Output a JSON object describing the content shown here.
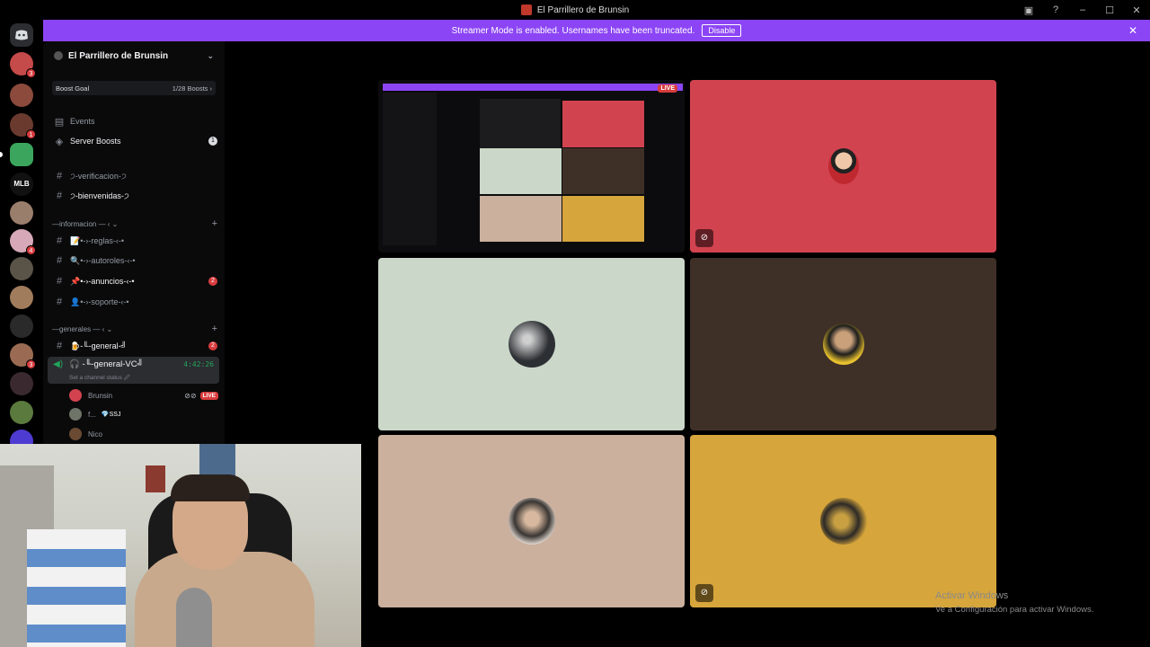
{
  "window": {
    "title": "El Parrillero de Brunsin"
  },
  "banner": {
    "text": "Streamer Mode is enabled. Usernames have been truncated.",
    "button": "Disable"
  },
  "server": {
    "name": "El Parrillero de Brunsin"
  },
  "boost_goal": {
    "label": "Boost Goal",
    "value": "1/28 Boosts ›"
  },
  "menu": {
    "events": "Events",
    "server_boosts": "Server Boosts",
    "server_boosts_count": "1"
  },
  "channels_top": [
    {
      "name": "੭-verificacion-੭"
    },
    {
      "name": "੭-bienvenidas-੭"
    }
  ],
  "category_info": "—informacion — ‹ ⌄",
  "channels_info": [
    {
      "name": "📝•-›-reglas-‹-•"
    },
    {
      "name": "🔍•-›-autoroles-‹-•"
    },
    {
      "name": "📌•-›-anuncios-‹-•",
      "count": "2"
    },
    {
      "name": "👤•-›-soporte-‹-•"
    }
  ],
  "category_general": "—generales — ‹ ⌄",
  "channel_general": {
    "name": "🍺-╙-general-╝",
    "count": "2"
  },
  "voice_channel": {
    "name": "🎧 -╙-general-VC╝",
    "time": "4:42:26",
    "status": "Set a channel status 🖉"
  },
  "voice_users": [
    {
      "name": "Brunsin",
      "live": "LIVE"
    },
    {
      "name": "f...",
      "tag": "💎SSJ"
    },
    {
      "name": "Nico"
    }
  ],
  "server_badges": [
    "3",
    "1",
    "4",
    "3"
  ],
  "tiles_live": "LIVE",
  "watermark": {
    "line1": "Activar Windows",
    "line2": "Ve a Configuración para activar Windows."
  },
  "colors": {
    "accent": "#8c45f5",
    "live": "#d83c3e",
    "tile_red": "#d24350",
    "tile_sage": "#cbd8c9",
    "tile_brown": "#3f3027",
    "tile_tan": "#cbb09e",
    "tile_gold": "#d6a53b"
  }
}
